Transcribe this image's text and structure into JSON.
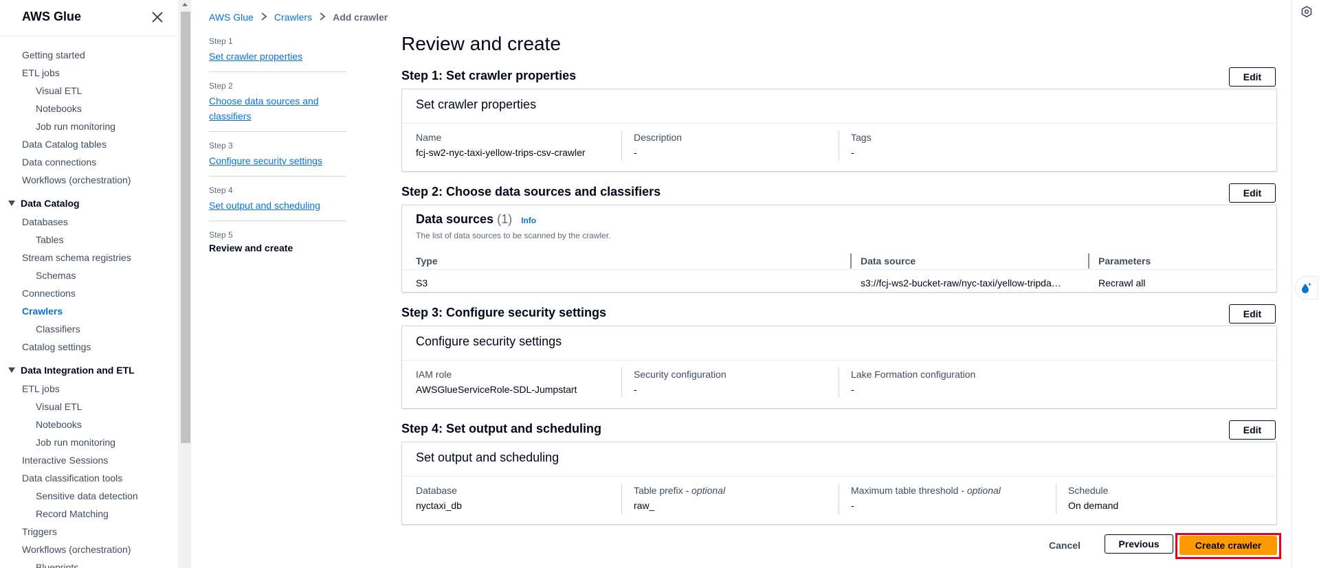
{
  "sidebar": {
    "title": "AWS Glue",
    "items_top": [
      {
        "label": "Getting started",
        "level": 1
      },
      {
        "label": "ETL jobs",
        "level": 1
      },
      {
        "label": "Visual ETL",
        "level": 2
      },
      {
        "label": "Notebooks",
        "level": 2
      },
      {
        "label": "Job run monitoring",
        "level": 2
      },
      {
        "label": "Data Catalog tables",
        "level": 1
      },
      {
        "label": "Data connections",
        "level": 1
      },
      {
        "label": "Workflows (orchestration)",
        "level": 1
      }
    ],
    "section_catalog": "Data Catalog",
    "items_catalog": [
      {
        "label": "Databases",
        "level": 1
      },
      {
        "label": "Tables",
        "level": 2
      },
      {
        "label": "Stream schema registries",
        "level": 1
      },
      {
        "label": "Schemas",
        "level": 2
      },
      {
        "label": "Connections",
        "level": 1
      },
      {
        "label": "Crawlers",
        "level": 1,
        "active": true
      },
      {
        "label": "Classifiers",
        "level": 2
      },
      {
        "label": "Catalog settings",
        "level": 1
      }
    ],
    "section_etl": "Data Integration and ETL",
    "items_etl": [
      {
        "label": "ETL jobs",
        "level": 1
      },
      {
        "label": "Visual ETL",
        "level": 2
      },
      {
        "label": "Notebooks",
        "level": 2
      },
      {
        "label": "Job run monitoring",
        "level": 2
      },
      {
        "label": "Interactive Sessions",
        "level": 1
      },
      {
        "label": "Data classification tools",
        "level": 1
      },
      {
        "label": "Sensitive data detection",
        "level": 2
      },
      {
        "label": "Record Matching",
        "level": 2
      },
      {
        "label": "Triggers",
        "level": 1
      },
      {
        "label": "Workflows (orchestration)",
        "level": 1
      },
      {
        "label": "Blueprints",
        "level": 2
      }
    ]
  },
  "breadcrumb": {
    "items": [
      "AWS Glue",
      "Crawlers"
    ],
    "current": "Add crawler"
  },
  "wizard": {
    "steps": [
      {
        "num": "Step 1",
        "label": "Set crawler properties"
      },
      {
        "num": "Step 2",
        "label": "Choose data sources and classifiers"
      },
      {
        "num": "Step 3",
        "label": "Configure security settings"
      },
      {
        "num": "Step 4",
        "label": "Set output and scheduling"
      },
      {
        "num": "Step 5",
        "label": "Review and create"
      }
    ]
  },
  "page": {
    "title": "Review and create",
    "edit_label": "Edit"
  },
  "step1": {
    "heading": "Step 1: Set crawler properties",
    "panel_title": "Set crawler properties",
    "name_label": "Name",
    "name_value": "fcj-sw2-nyc-taxi-yellow-trips-csv-crawler",
    "desc_label": "Description",
    "desc_value": "-",
    "tags_label": "Tags",
    "tags_value": "-"
  },
  "step2": {
    "heading": "Step 2: Choose data sources and classifiers",
    "panel_title": "Data sources",
    "count": "(1)",
    "info": "Info",
    "description": "The list of data sources to be scanned by the crawler.",
    "columns": [
      "Type",
      "Data source",
      "Parameters"
    ],
    "rows": [
      [
        "S3",
        "s3://fcj-ws2-bucket-raw/nyc-taxi/yellow-tripda…",
        "Recrawl all"
      ]
    ]
  },
  "step3": {
    "heading": "Step 3: Configure security settings",
    "panel_title": "Configure security settings",
    "iam_label": "IAM role",
    "iam_value": "AWSGlueServiceRole-SDL-Jumpstart",
    "secconf_label": "Security configuration",
    "secconf_value": "-",
    "lake_label": "Lake Formation configuration",
    "lake_value": "-"
  },
  "step4": {
    "heading": "Step 4: Set output and scheduling",
    "panel_title": "Set output and scheduling",
    "db_label": "Database",
    "db_value": "nyctaxi_db",
    "prefix_label": "Table prefix",
    "prefix_opt": "- optional",
    "prefix_value": "raw_",
    "threshold_label": "Maximum table threshold",
    "threshold_opt": "- optional",
    "threshold_value": "-",
    "schedule_label": "Schedule",
    "schedule_value": "On demand"
  },
  "footer": {
    "cancel": "Cancel",
    "previous": "Previous",
    "create": "Create crawler"
  },
  "colors": {
    "primary_button": "#ff9900",
    "link": "#0972d3",
    "highlight": "#e3001b"
  }
}
